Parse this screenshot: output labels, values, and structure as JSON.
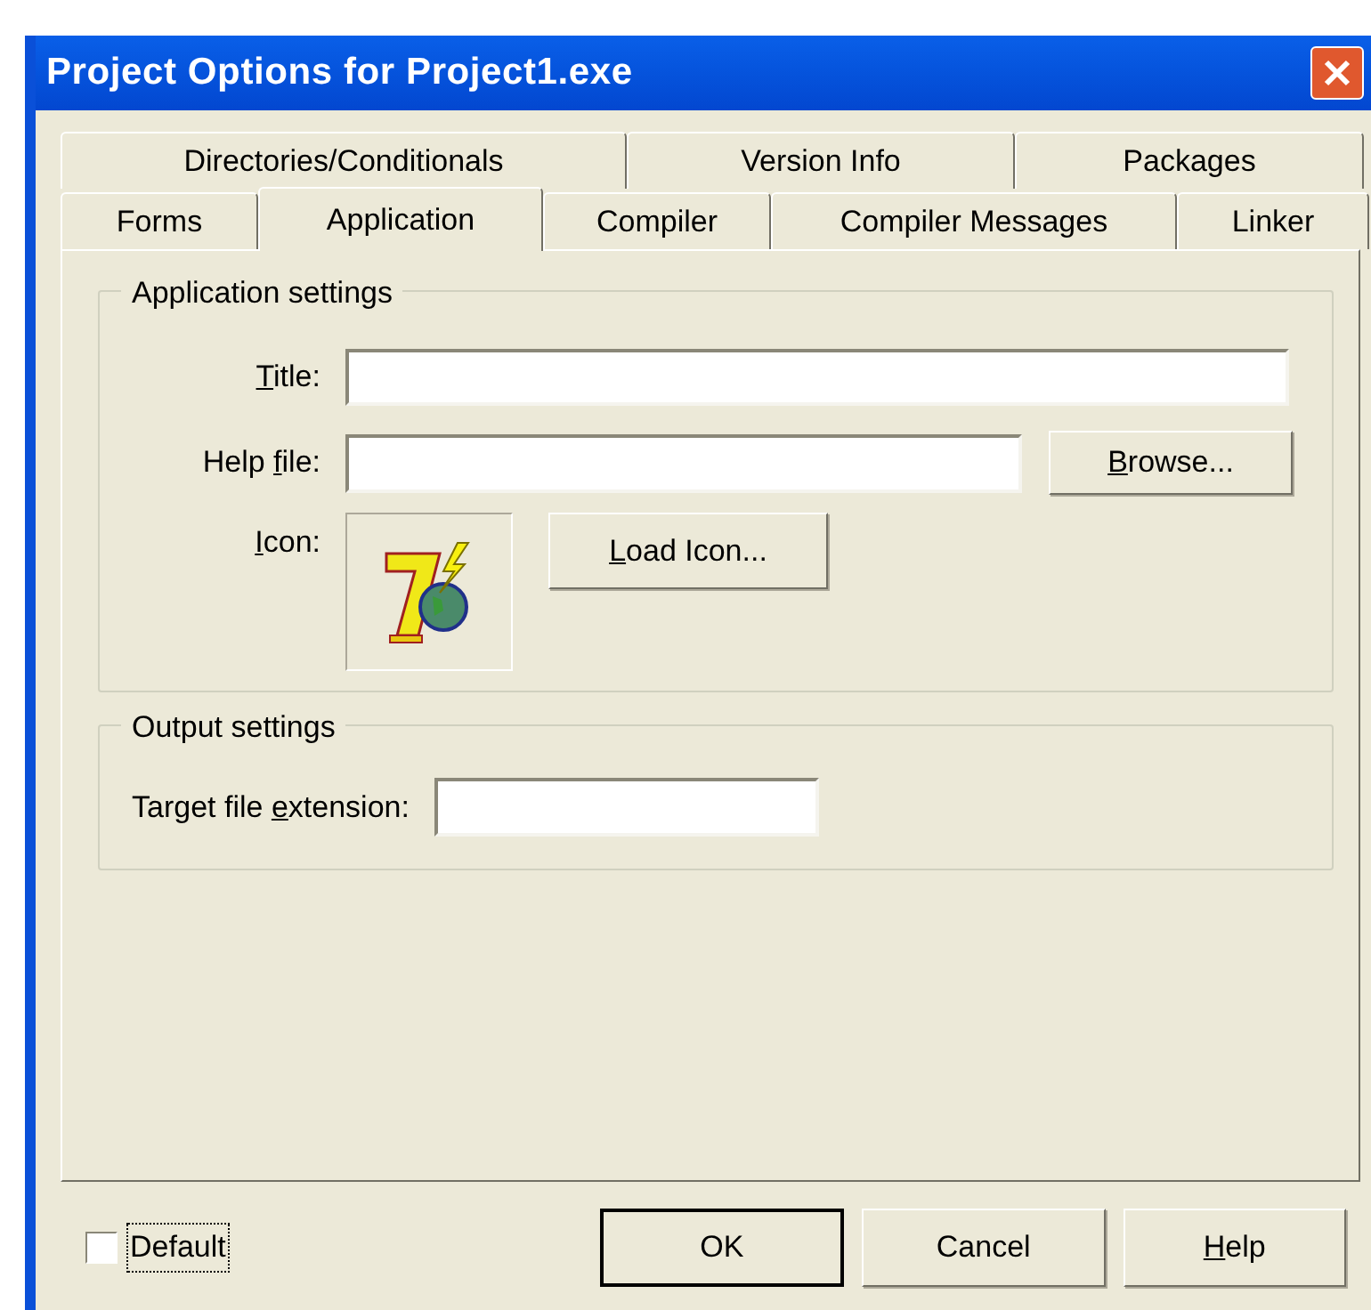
{
  "window": {
    "title": "Project Options for Project1.exe"
  },
  "tab_rows": [
    [
      {
        "label": "Directories/Conditionals",
        "selected": false
      },
      {
        "label": "Version Info",
        "selected": false
      },
      {
        "label": "Packages",
        "selected": false
      }
    ],
    [
      {
        "label": "Forms",
        "selected": false
      },
      {
        "label": "Application",
        "selected": true
      },
      {
        "label": "Compiler",
        "selected": false
      },
      {
        "label": "Compiler Messages",
        "selected": false
      },
      {
        "label": "Linker",
        "selected": false
      }
    ]
  ],
  "application_settings": {
    "legend": "Application settings",
    "title_label": [
      {
        "text": "T",
        "underlined": true
      },
      {
        "text": "itle:",
        "underlined": false
      }
    ],
    "help_file_label": [
      {
        "text": "Help ",
        "underlined": false
      },
      {
        "text": "f",
        "underlined": true
      },
      {
        "text": "ile:",
        "underlined": false
      }
    ],
    "browse_button": [
      {
        "text": "B",
        "underlined": true
      },
      {
        "text": "rowse...",
        "underlined": false
      }
    ],
    "icon_label": [
      {
        "text": "I",
        "underlined": true
      },
      {
        "text": "con:",
        "underlined": false
      }
    ],
    "load_icon_button": [
      {
        "text": "L",
        "underlined": true
      },
      {
        "text": "oad Icon...",
        "underlined": false
      }
    ]
  },
  "output_settings": {
    "legend": "Output settings",
    "extension_label": [
      {
        "text": "Target file ",
        "underlined": false
      },
      {
        "text": "e",
        "underlined": true
      },
      {
        "text": "xtension:",
        "underlined": false
      }
    ]
  },
  "default_checkbox": {
    "label": "Default",
    "checked": false
  },
  "buttons": [
    {
      "label": [
        {
          "text": "OK",
          "underlined": false
        }
      ],
      "default": true
    },
    {
      "label": [
        {
          "text": "Cancel",
          "underlined": false
        }
      ],
      "default": false
    },
    {
      "label": [
        {
          "text": "H",
          "underlined": true
        },
        {
          "text": "elp",
          "underlined": false
        }
      ],
      "default": false
    }
  ]
}
